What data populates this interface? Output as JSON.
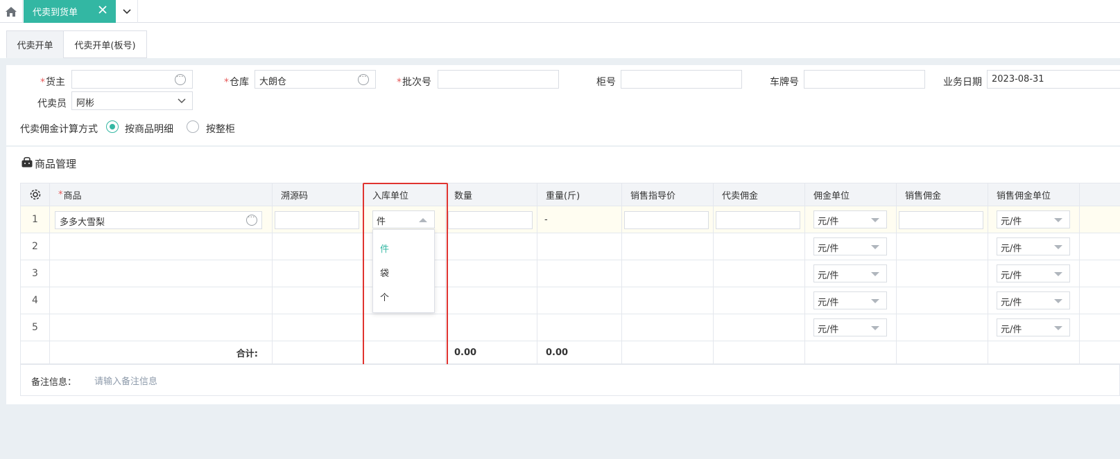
{
  "topbar": {
    "home_icon": "home-icon",
    "active_tab": "代卖到货单",
    "close_icon": "close-icon",
    "more_icon": "chevron-down-icon"
  },
  "subtabs": [
    "代卖开单",
    "代卖开单(板号)"
  ],
  "form": {
    "owner_label": "货主",
    "owner_value": "",
    "warehouse_label": "仓库",
    "warehouse_value": "大朗仓",
    "batch_label": "批次号",
    "batch_value": "",
    "cabinet_label": "柜号",
    "cabinet_value": "",
    "plate_label": "车牌号",
    "plate_value": "",
    "date_label": "业务日期",
    "date_value": "2023-08-31",
    "agent_label": "代卖员",
    "agent_value": "阿彬",
    "commission_label": "代卖佣金计算方式",
    "commission_options": [
      "按商品明细",
      "按整柜"
    ],
    "commission_selected": "按商品明细"
  },
  "goods": {
    "title": "商品管理",
    "columns": [
      "商品",
      "溯源码",
      "入库单位",
      "数量",
      "重量(斤)",
      "销售指导价",
      "代卖佣金",
      "佣金单位",
      "销售佣金",
      "销售佣金单位"
    ],
    "rows": [
      {
        "num": "1",
        "product": "多多大雪梨",
        "unit": "件",
        "weight": "-",
        "commission_unit": "元/件",
        "sales_commission_unit": "元/件"
      },
      {
        "num": "2",
        "commission_unit": "元/件",
        "sales_commission_unit": "元/件"
      },
      {
        "num": "3",
        "commission_unit": "元/件",
        "sales_commission_unit": "元/件"
      },
      {
        "num": "4",
        "commission_unit": "元/件",
        "sales_commission_unit": "元/件"
      },
      {
        "num": "5",
        "commission_unit": "元/件",
        "sales_commission_unit": "元/件"
      }
    ],
    "total_label": "合计:",
    "total_quantity": "0.00",
    "total_weight": "0.00",
    "unit_dropdown_options": [
      "件",
      "袋",
      "个"
    ],
    "unit_dropdown_selected": "件"
  },
  "remark": {
    "label": "备注信息：",
    "placeholder": "请输入备注信息"
  },
  "colors": {
    "accent": "#33b7a3",
    "required": "#e65a5a",
    "highlight": "#e0332f",
    "row_highlight": "#fffdf1"
  }
}
